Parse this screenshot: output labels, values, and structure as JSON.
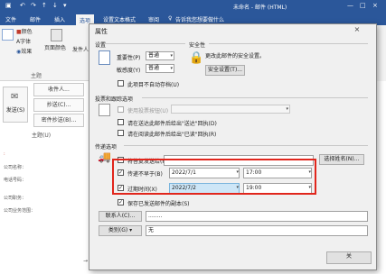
{
  "window": {
    "title": "未命名 - 邮件 (HTML)"
  },
  "ribbon_tabs": [
    "文件",
    "邮件",
    "插入",
    "选项",
    "设置文本格式",
    "审阅"
  ],
  "ribbon_search_placeholder": "告诉我您想要做什么",
  "ribbon": {
    "theme_group": {
      "items": [
        "颜色",
        "字体",
        "效果"
      ],
      "label": "主题",
      "page_color": "页面颜色"
    },
    "sender_label": "发件人"
  },
  "compose": {
    "send_label": "发送(S)",
    "to_button": "收件人...",
    "cc_button": "抄送(C)...",
    "bcc_button": "密件抄送(B)...",
    "subject_label": "主题(U)",
    "signature_lines": [
      "公司名称：",
      "电话号码：",
      "公司职务：",
      "公司业务范围："
    ],
    "footer_arrow": "→"
  },
  "dialog": {
    "title": "属性",
    "close_glyph": "×",
    "settings": {
      "header": "设置",
      "importance_label": "重要性(P)",
      "importance_value": "普通",
      "sensitivity_label": "敏感度(Y)",
      "sensitivity_value": "普通",
      "no_autoarchive": "此项目不自动存档(U)"
    },
    "security": {
      "header": "安全性",
      "desc": "更改此邮件的安全设置。",
      "button": "安全设置(T)..."
    },
    "voting": {
      "header": "投票和跟踪选项",
      "use_voting": "使用投票按钮(U)",
      "delivery_receipt": "请在送达此邮件后给出\"送达\"回执(D)",
      "read_receipt": "请在阅读此邮件后给出\"已读\"回执(R)"
    },
    "delivery": {
      "header": "传递选项",
      "reply_to": "将答复发送给(H)",
      "select_names": "选择姓名(N)...",
      "do_not_deliver_before": {
        "label": "传递不早于(B)",
        "date": "2022/7/1",
        "time": "17:00",
        "checked": true
      },
      "expires_after": {
        "label": "过期时间(X)",
        "date": "2022/7/2",
        "time": "19:00",
        "checked": true
      },
      "save_copy": "保存已发送邮件的副本(S)"
    },
    "contacts_button": "联系人(C)...",
    "contacts_value": "........",
    "categories_button": "类别(G)",
    "categories_value": "无",
    "close_button": "关"
  }
}
